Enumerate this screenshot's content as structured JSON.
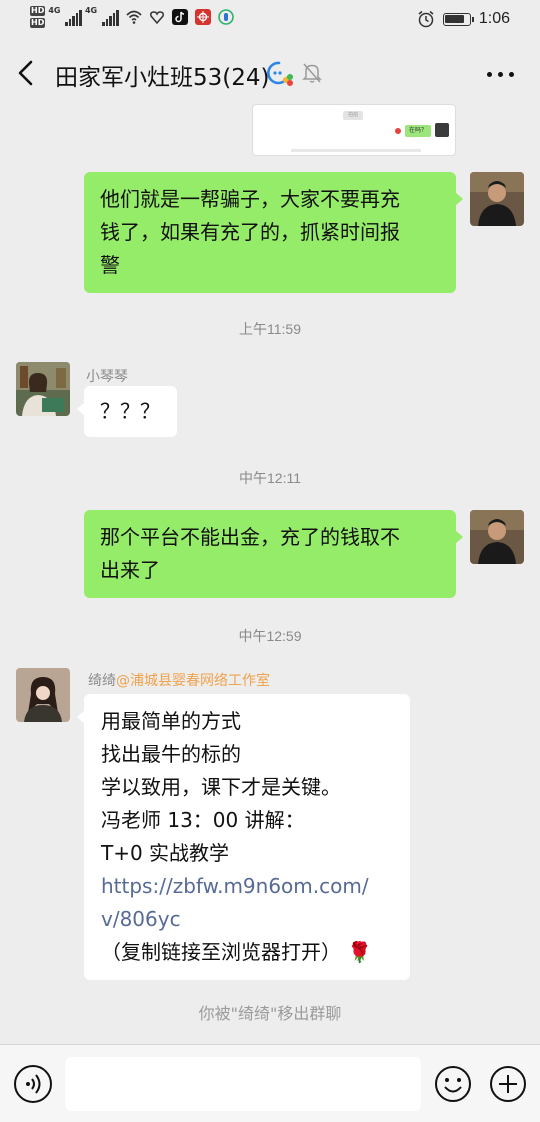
{
  "status_bar": {
    "time": "1:06",
    "network": "4G",
    "hd_label": "HD",
    "battery_level": 0.8
  },
  "chat": {
    "title": "田家军小灶班53(24)",
    "muted": true
  },
  "image_message": {
    "preview_bubble": "在吗？",
    "preview_pill": "拍拍"
  },
  "messages": [
    {
      "direction": "out",
      "lines": [
        "他们就是一帮骗子，大家不要再充",
        "钱了，如果有充了的，抓紧时间报",
        "警"
      ]
    },
    {
      "timestamp": "上午11:59"
    },
    {
      "direction": "in",
      "sender": "小琴琴",
      "lines": [
        "？？？"
      ]
    },
    {
      "timestamp": "中午12:11"
    },
    {
      "direction": "out",
      "lines": [
        "那个平台不能出金，充了的钱取不",
        "出来了"
      ]
    },
    {
      "timestamp": "中午12:59"
    },
    {
      "direction": "in",
      "sender": "绮绮",
      "sender_org": "@浦城县婴春网络工作室",
      "lines": [
        "用最简单的方式",
        "找出最牛的标的",
        "学以致用，课下才是关键。",
        "冯老师 13：00 讲解：",
        "T+0 实战教学"
      ],
      "link_lines": [
        "https://zbfw.m9n6om.com/",
        "v/806yc"
      ],
      "closing_line": "（复制链接至浏览器打开）",
      "closing_emoji": "🌹"
    }
  ],
  "system_notice": "你被\"绮绮\"移出群聊",
  "input_bar": {
    "placeholder": ""
  }
}
